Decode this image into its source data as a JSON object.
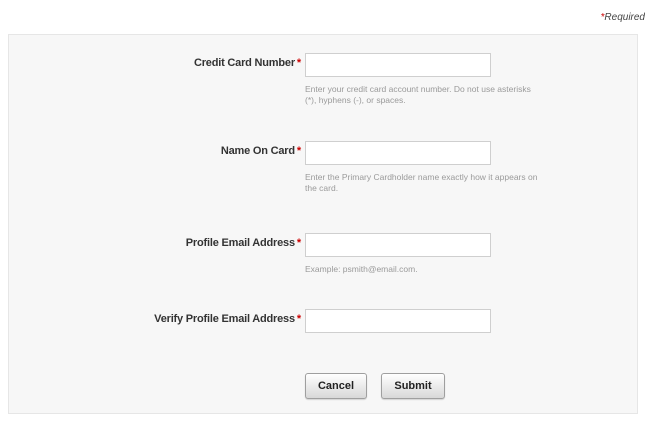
{
  "required_note": {
    "star": "*",
    "text": "Required"
  },
  "form": {
    "card_number": {
      "label": "Credit Card Number",
      "required_mark": "*",
      "value": "",
      "hint": "Enter your credit card account number. Do not use asterisks (*), hyphens (-), or spaces."
    },
    "name_on_card": {
      "label": "Name On Card",
      "required_mark": "*",
      "value": "",
      "hint": "Enter the Primary Cardholder name exactly how it appears on the card."
    },
    "profile_email": {
      "label": "Profile Email Address",
      "required_mark": "*",
      "value": "",
      "hint": "Example: psmith@email.com."
    },
    "verify_email": {
      "label": "Verify Profile Email Address",
      "required_mark": "*",
      "value": ""
    }
  },
  "buttons": {
    "cancel": "Cancel",
    "submit": "Submit"
  }
}
